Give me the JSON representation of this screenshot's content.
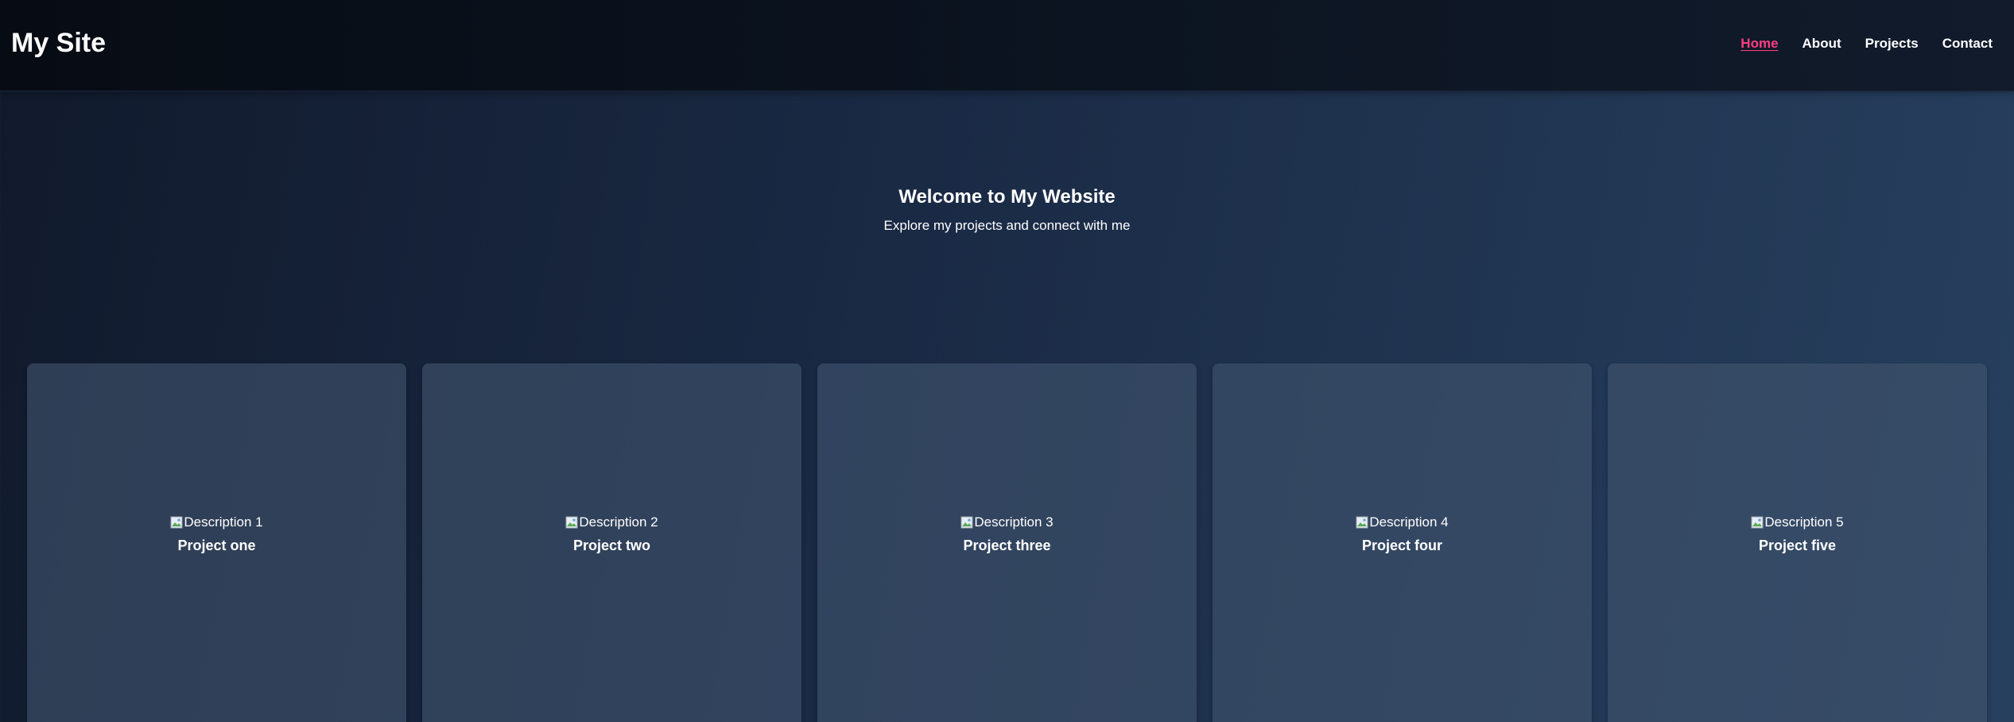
{
  "header": {
    "brand": "My Site",
    "nav": [
      {
        "label": "Home",
        "active": true
      },
      {
        "label": "About",
        "active": false
      },
      {
        "label": "Projects",
        "active": false
      },
      {
        "label": "Contact",
        "active": false
      }
    ]
  },
  "hero": {
    "title": "Welcome to My Website",
    "subtitle": "Explore my projects and connect with me"
  },
  "projects": [
    {
      "image_alt": "Description 1",
      "title": "Project one"
    },
    {
      "image_alt": "Description 2",
      "title": "Project two"
    },
    {
      "image_alt": "Description 3",
      "title": "Project three"
    },
    {
      "image_alt": "Description 4",
      "title": "Project four"
    },
    {
      "image_alt": "Description 5",
      "title": "Project five"
    }
  ],
  "colors": {
    "active_link": "#ff3d82",
    "header_bg": "#0a111c",
    "card_bg": "#3a4a62"
  },
  "icons": {
    "card_image": "broken-image-icon"
  }
}
